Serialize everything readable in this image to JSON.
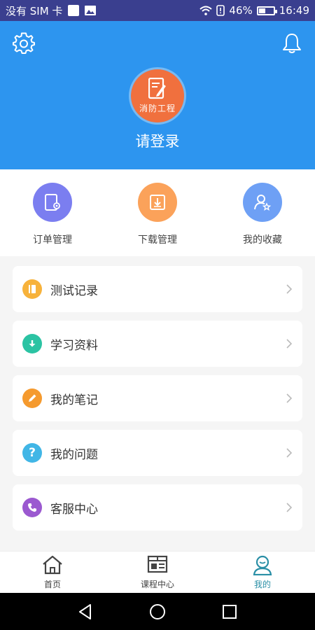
{
  "status_bar": {
    "carrier": "没有 SIM 卡",
    "battery": "46%",
    "battery_level": 0.46,
    "time": "16:49"
  },
  "header": {
    "settings_icon": "gear-icon",
    "notification_icon": "bell-icon",
    "logo_text": "消防工程",
    "login_text": "请登录"
  },
  "quick_actions": [
    {
      "label": "订单管理",
      "icon": "order-icon",
      "color": "#7b7ef0"
    },
    {
      "label": "下载管理",
      "icon": "download-icon",
      "color": "#fba25a"
    },
    {
      "label": "我的收藏",
      "icon": "favorite-icon",
      "color": "#6ea0f5"
    }
  ],
  "menu": [
    {
      "label": "测试记录",
      "icon": "book-icon",
      "color": "#f7b23b"
    },
    {
      "label": "学习资料",
      "icon": "download-arrow-icon",
      "color": "#2bc3a3"
    },
    {
      "label": "我的笔记",
      "icon": "pencil-icon",
      "color": "#f59a2e"
    },
    {
      "label": "我的问题",
      "icon": "question-icon",
      "color": "#41b6e6"
    },
    {
      "label": "客服中心",
      "icon": "phone-icon",
      "color": "#9b59d0"
    }
  ],
  "tabs": [
    {
      "label": "首页",
      "icon": "home-icon",
      "active": false
    },
    {
      "label": "课程中心",
      "icon": "course-icon",
      "active": false
    },
    {
      "label": "我的",
      "icon": "profile-icon",
      "active": true
    }
  ],
  "colors": {
    "status_bar": "#3a3f8f",
    "header": "#2d95ef",
    "active_tab": "#2a8fa6"
  }
}
